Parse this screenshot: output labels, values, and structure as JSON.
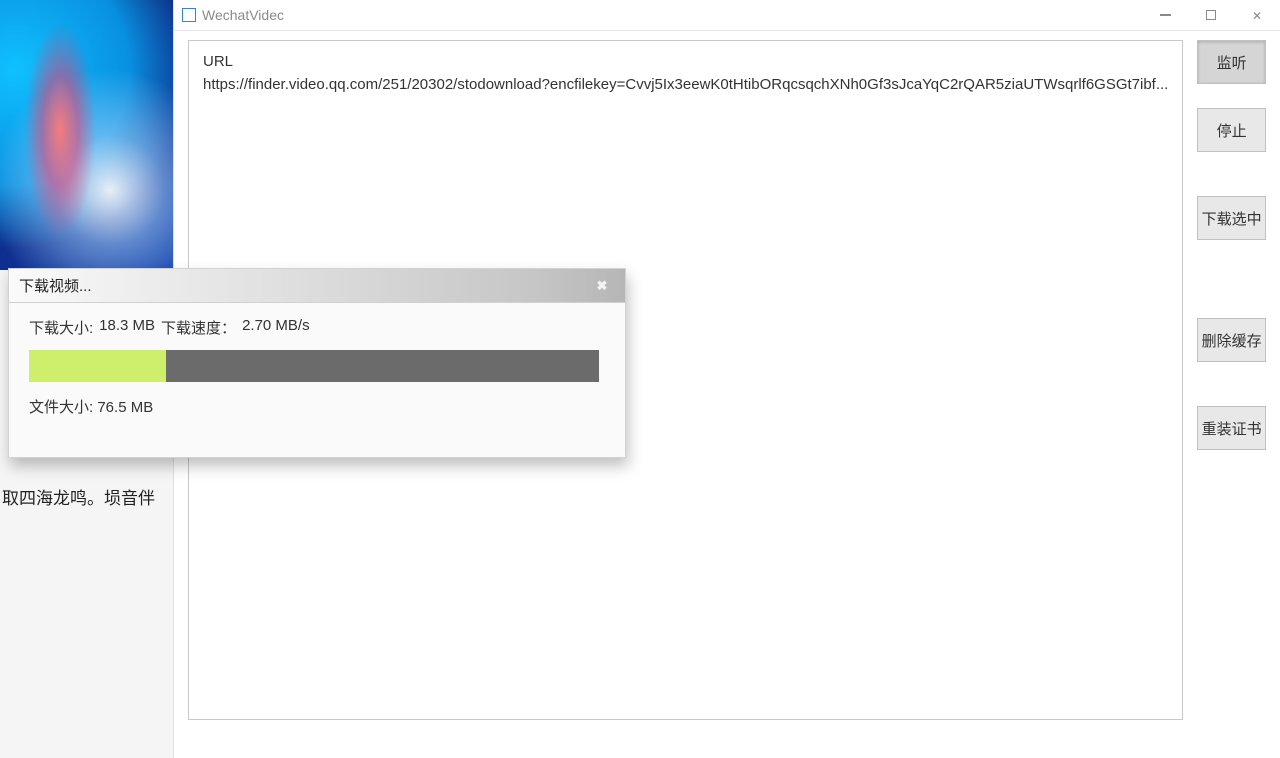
{
  "background": {
    "text_line": "取四海龙鸣。埙音伴"
  },
  "window": {
    "title": "WechatVidec"
  },
  "url_list": {
    "header": "URL",
    "url": "https://finder.video.qq.com/251/20302/stodownload?encfilekey=Cvvj5Ix3eewK0tHtibORqcsqchXNh0Gf3sJcaYqC2rQAR5ziaUTWsqrlf6GSGt7ibf..."
  },
  "buttons": {
    "listen": "监听",
    "stop": "停止",
    "download_selected": "下载选中",
    "clear_cache": "删除缓存",
    "reinstall_cert": "重装证书"
  },
  "dialog": {
    "title": "下载视频...",
    "size_label": "下载大小:",
    "size_value": "18.3 MB",
    "speed_label": "下载速度：",
    "speed_value": "2.70 MB/s",
    "file_label": "文件大小:",
    "file_value": "76.5 MB",
    "progress_percent": 24
  }
}
